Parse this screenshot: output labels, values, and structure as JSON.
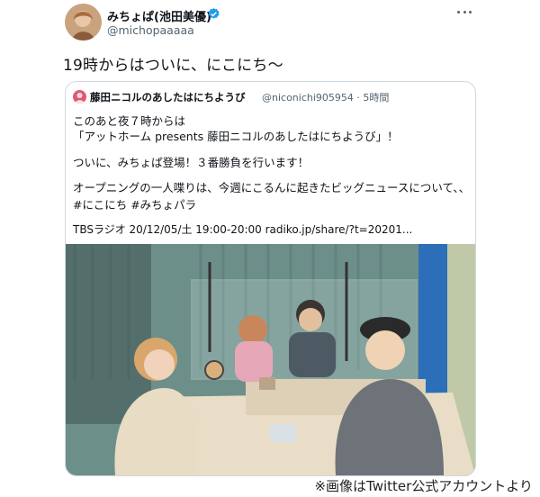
{
  "tweet": {
    "author_name": "みちょぱ(池田美優)",
    "author_handle": "@michopaaaaa",
    "text": "19時からはついに、にこにち〜",
    "avatar_icon": "avatar-photo",
    "verified_icon": "verified-badge-icon",
    "more_icon": "more-options-icon"
  },
  "quoted_tweet": {
    "author_name": "藤田ニコルのあしたはにちようび",
    "author_handle_time": "@niconichi905954 · 5時間",
    "lines": [
      "このあと夜７時からは",
      "「アットホーム presents 藤田ニコルのあしたはにちようび」！",
      "ついに、みちょぱ登場！３番勝負を行います！",
      "オープニングの一人喋りは、今週にこるんに起きたビッグニュースについて、、",
      "#にこにち #みちょパラ",
      "TBSラジオ 20/12/05/土 19:00-20:00 radiko.jp/share/?t=20201..."
    ]
  },
  "caption": "※画像はTwitter公式アカウントより",
  "colors": {
    "text_primary": "#0f1419",
    "text_secondary": "#536471",
    "verified_blue": "#1d9bf0",
    "border": "#cfd9de"
  }
}
